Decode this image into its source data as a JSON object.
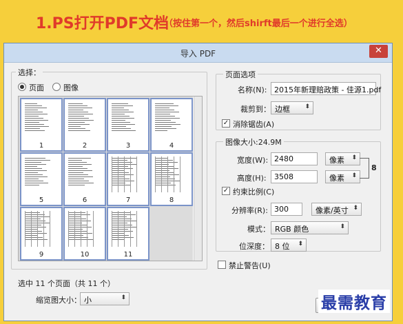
{
  "banner": {
    "title": "1.PS打开PDF文档",
    "subtitle": "（按住第一个，然后shirft最后一个进行全选）"
  },
  "dialog": {
    "title": "导入 PDF",
    "close": "✕"
  },
  "select_group": {
    "legend": "选择：",
    "page_option": "页面",
    "image_option": "图像"
  },
  "thumbnails": [
    "1",
    "2",
    "3",
    "4",
    "5",
    "6",
    "7",
    "8",
    "9",
    "10",
    "11"
  ],
  "selection_status": "选中 11 个页面（共 11 个）",
  "thumb_size": {
    "label": "缩览图大小：",
    "value": "小"
  },
  "page_options": {
    "legend": "页面选项",
    "name_label": "名称(N):",
    "name_value": "2015年新理赔政策 - 佳源1.pdf",
    "crop_label": "裁剪到：",
    "crop_value": "边框",
    "anti_alias_label": "消除锯齿(A)"
  },
  "image_size": {
    "legend": "图像大小:24.9M",
    "width_label": "宽度(W):",
    "width_value": "2480",
    "width_unit": "像素",
    "height_label": "高度(H):",
    "height_value": "3508",
    "height_unit": "像素",
    "constrain_label": "约束比例(C)",
    "resolution_label": "分辨率(R):",
    "resolution_value": "300",
    "resolution_unit": "像素/英寸",
    "mode_label": "模式：",
    "mode_value": "RGB 颜色",
    "depth_label": "位深度：",
    "depth_value": "8 位"
  },
  "suppress_warnings_label": "禁止警告(U)",
  "watermark": "最需教育"
}
